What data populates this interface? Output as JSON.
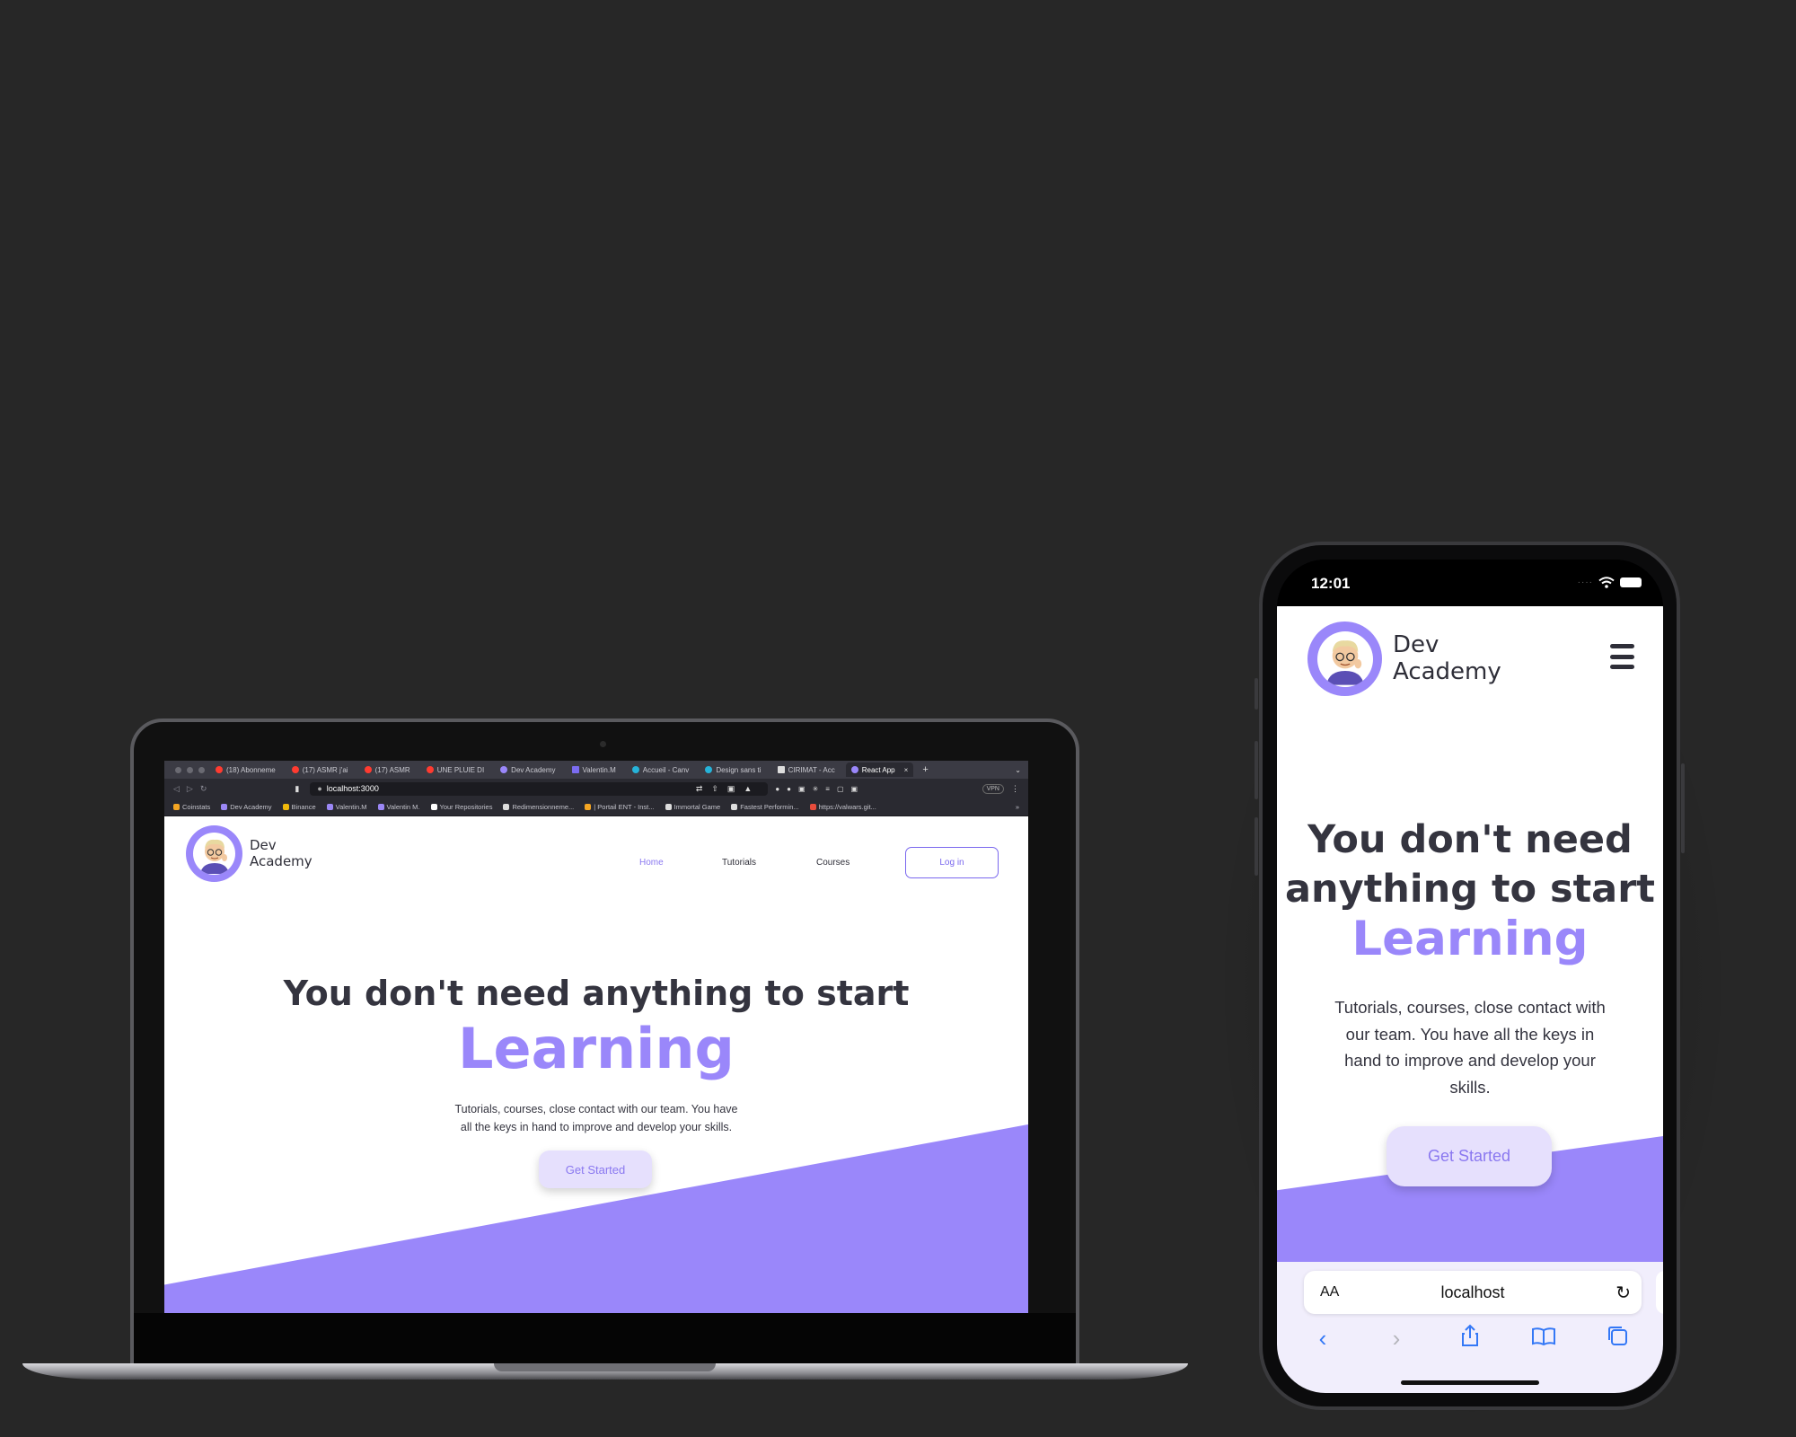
{
  "colors": {
    "background": "#272727",
    "accent": "#9a87fa",
    "accent_dark": "#7a68ee",
    "button_bg": "#e6e0fd",
    "text": "#34343f"
  },
  "laptop": {
    "browser": {
      "tabs": [
        {
          "label": "(18) Abonneme",
          "icon": "youtube-icon"
        },
        {
          "label": "(17) ASMR j'ai",
          "icon": "youtube-icon"
        },
        {
          "label": "(17) ASMR",
          "icon": "youtube-icon"
        },
        {
          "label": "UNE PLUIE DI",
          "icon": "youtube-icon"
        },
        {
          "label": "Dev Academy",
          "icon": "dev-academy-icon"
        },
        {
          "label": "Valentin.M",
          "icon": "arrow-logo-icon"
        },
        {
          "label": "Accueil - Canv",
          "icon": "canva-icon"
        },
        {
          "label": "Design sans ti",
          "icon": "canva-icon"
        },
        {
          "label": "CIRIMAT - Acc",
          "icon": "page-icon"
        },
        {
          "label": "React App",
          "icon": "react-icon"
        }
      ],
      "url": "localhost:3000",
      "vpn_label": "VPN",
      "bookmarks": [
        "Coinstats",
        "Dev Academy",
        "Binance",
        "Valentin.M",
        "Valentin M.",
        "Your Repositories",
        "Redimensionneme...",
        "| Portail ENT - Inst...",
        "Immortal Game",
        "Fastest Performin...",
        "https://valwars.git..."
      ]
    },
    "site": {
      "logo_line1": "Dev",
      "logo_line2": "Academy",
      "nav": [
        {
          "label": "Home",
          "active": true
        },
        {
          "label": "Tutorials",
          "active": false
        },
        {
          "label": "Courses",
          "active": false
        }
      ],
      "login_label": "Log in",
      "hero_title": "You don't need anything to start",
      "hero_highlight": "Learning",
      "hero_desc_line1": "Tutorials, courses, close contact with our team. You have",
      "hero_desc_line2": "all the keys in hand to improve and develop your skills.",
      "cta_label": "Get Started"
    }
  },
  "phone": {
    "status": {
      "time": "12:01"
    },
    "site": {
      "logo_line1": "Dev",
      "logo_line2": "Academy",
      "hero_title_line1": "You don't need",
      "hero_title_line2": "anything to start",
      "hero_highlight": "Learning",
      "hero_desc_line1": "Tutorials, courses, close contact with",
      "hero_desc_line2": "our team. You have all the keys in",
      "hero_desc_line3": "hand to improve and develop your",
      "hero_desc_line4": "skills.",
      "cta_label": "Get Started"
    },
    "safari": {
      "text_size_label": "AA",
      "host": "localhost"
    }
  }
}
